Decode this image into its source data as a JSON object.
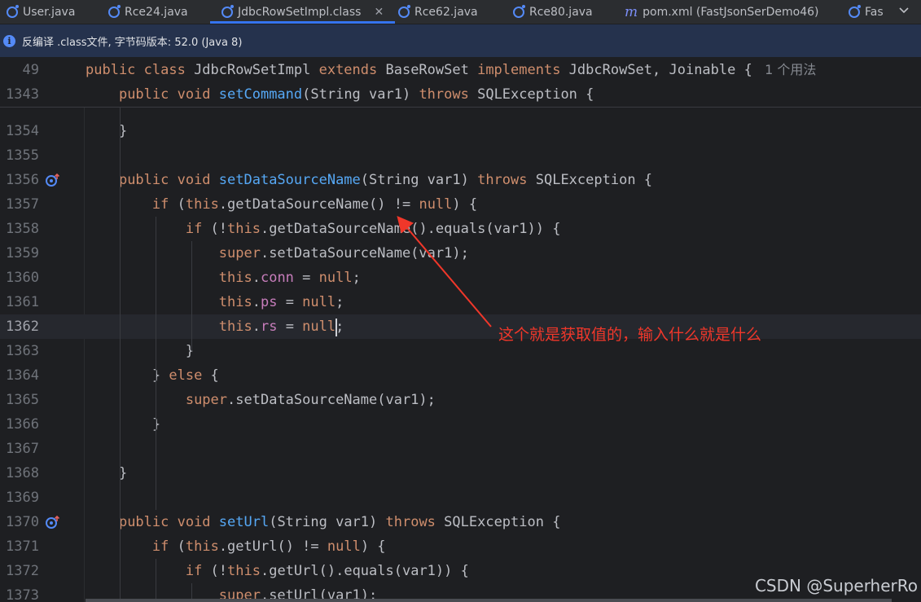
{
  "tabs": [
    {
      "label": "User.java",
      "icon": "class-icon",
      "active": false
    },
    {
      "label": "Rce24.java",
      "icon": "class-icon",
      "active": false
    },
    {
      "label": "JdbcRowSetImpl.class",
      "icon": "class-icon",
      "active": true
    },
    {
      "label": "Rce62.java",
      "icon": "class-icon",
      "active": false
    },
    {
      "label": "Rce80.java",
      "icon": "class-icon",
      "active": false
    },
    {
      "label": "pom.xml (FastJsonSerDemo46)",
      "icon": "maven-icon",
      "active": false
    },
    {
      "label": "Fas",
      "icon": "class-icon",
      "active": false
    }
  ],
  "banner": {
    "text": "反编译 .class文件, 字节码版本: 52.0 (Java 8)"
  },
  "sticky_lines": [
    {
      "num": "49",
      "tokens": [
        [
          "kw",
          "public class "
        ],
        [
          "",
          "JdbcRowSetImpl "
        ],
        [
          "kw",
          "extends "
        ],
        [
          "",
          "BaseRowSet "
        ],
        [
          "kw",
          "implements "
        ],
        [
          "",
          "JdbcRowSet, Joinable { "
        ],
        [
          "hint",
          " 1 个用法"
        ]
      ]
    },
    {
      "num": "1343",
      "tokens": [
        [
          "",
          "    "
        ],
        [
          "kw",
          "public void "
        ],
        [
          "fn",
          "setCommand"
        ],
        [
          "",
          "(String var1) "
        ],
        [
          "kw",
          "throws "
        ],
        [
          "",
          "SQLException {"
        ]
      ]
    }
  ],
  "lines": [
    {
      "num": "1354",
      "tokens": [
        [
          "",
          "    }"
        ]
      ]
    },
    {
      "num": "1355",
      "tokens": []
    },
    {
      "num": "1356",
      "icon": true,
      "tokens": [
        [
          "",
          "    "
        ],
        [
          "kw",
          "public void "
        ],
        [
          "fn",
          "setDataSourceName"
        ],
        [
          "",
          "(String var1) "
        ],
        [
          "kw",
          "throws "
        ],
        [
          "",
          "SQLException {"
        ]
      ]
    },
    {
      "num": "1357",
      "tokens": [
        [
          "",
          "        "
        ],
        [
          "kw",
          "if "
        ],
        [
          "",
          "("
        ],
        [
          "kw",
          "this"
        ],
        [
          "",
          ".getDataSourceName() != "
        ],
        [
          "kw",
          "null"
        ],
        [
          "",
          ") {"
        ]
      ]
    },
    {
      "num": "1358",
      "tokens": [
        [
          "",
          "            "
        ],
        [
          "kw",
          "if "
        ],
        [
          "",
          "(!"
        ],
        [
          "kw",
          "this"
        ],
        [
          "",
          ".getDataSourceName().equals(var1)) {"
        ]
      ]
    },
    {
      "num": "1359",
      "tokens": [
        [
          "",
          "                "
        ],
        [
          "kw",
          "super"
        ],
        [
          "",
          ".setDataSourceName(var1);"
        ]
      ]
    },
    {
      "num": "1360",
      "tokens": [
        [
          "",
          "                "
        ],
        [
          "kw",
          "this"
        ],
        [
          "",
          "."
        ],
        [
          "fld",
          "conn"
        ],
        [
          "",
          " = "
        ],
        [
          "kw",
          "null"
        ],
        [
          "",
          ";"
        ]
      ]
    },
    {
      "num": "1361",
      "tokens": [
        [
          "",
          "                "
        ],
        [
          "kw",
          "this"
        ],
        [
          "",
          "."
        ],
        [
          "fld",
          "ps"
        ],
        [
          "",
          " = "
        ],
        [
          "kw",
          "null"
        ],
        [
          "",
          ";"
        ]
      ]
    },
    {
      "num": "1362",
      "current": true,
      "tokens": [
        [
          "",
          "                "
        ],
        [
          "kw",
          "this"
        ],
        [
          "",
          "."
        ],
        [
          "fld",
          "rs"
        ],
        [
          "",
          " = "
        ],
        [
          "kw",
          "null"
        ],
        [
          "",
          ";"
        ]
      ]
    },
    {
      "num": "1363",
      "tokens": [
        [
          "",
          "            }"
        ]
      ]
    },
    {
      "num": "1364",
      "tokens": [
        [
          "",
          "        } "
        ],
        [
          "kw",
          "else "
        ],
        [
          "",
          "{"
        ]
      ]
    },
    {
      "num": "1365",
      "tokens": [
        [
          "",
          "            "
        ],
        [
          "kw",
          "super"
        ],
        [
          "",
          ".setDataSourceName(var1);"
        ]
      ]
    },
    {
      "num": "1366",
      "tokens": [
        [
          "",
          "        }"
        ]
      ]
    },
    {
      "num": "1367",
      "tokens": []
    },
    {
      "num": "1368",
      "tokens": [
        [
          "",
          "    }"
        ]
      ]
    },
    {
      "num": "1369",
      "tokens": []
    },
    {
      "num": "1370",
      "icon": true,
      "tokens": [
        [
          "",
          "    "
        ],
        [
          "kw",
          "public void "
        ],
        [
          "fn",
          "setUrl"
        ],
        [
          "",
          "(String var1) "
        ],
        [
          "kw",
          "throws "
        ],
        [
          "",
          "SQLException {"
        ]
      ]
    },
    {
      "num": "1371",
      "tokens": [
        [
          "",
          "        "
        ],
        [
          "kw",
          "if "
        ],
        [
          "",
          "("
        ],
        [
          "kw",
          "this"
        ],
        [
          "",
          ".getUrl() != "
        ],
        [
          "kw",
          "null"
        ],
        [
          "",
          ") {"
        ]
      ]
    },
    {
      "num": "1372",
      "tokens": [
        [
          "",
          "            "
        ],
        [
          "kw",
          "if "
        ],
        [
          "",
          "(!"
        ],
        [
          "kw",
          "this"
        ],
        [
          "",
          ".getUrl().equals(var1)) {"
        ]
      ]
    },
    {
      "num": "1373",
      "tokens": [
        [
          "",
          "                "
        ],
        [
          "kw",
          "super"
        ],
        [
          "",
          ".setUrl(var1);"
        ]
      ]
    }
  ],
  "annotation": "这个就是获取值的，输入什么就是什么",
  "watermark": "CSDN @SuperherRo",
  "colors": {
    "keyword": "#cf8e6d",
    "method": "#56a8f5",
    "field": "#c77dbb",
    "annotation": "#f0372a"
  }
}
